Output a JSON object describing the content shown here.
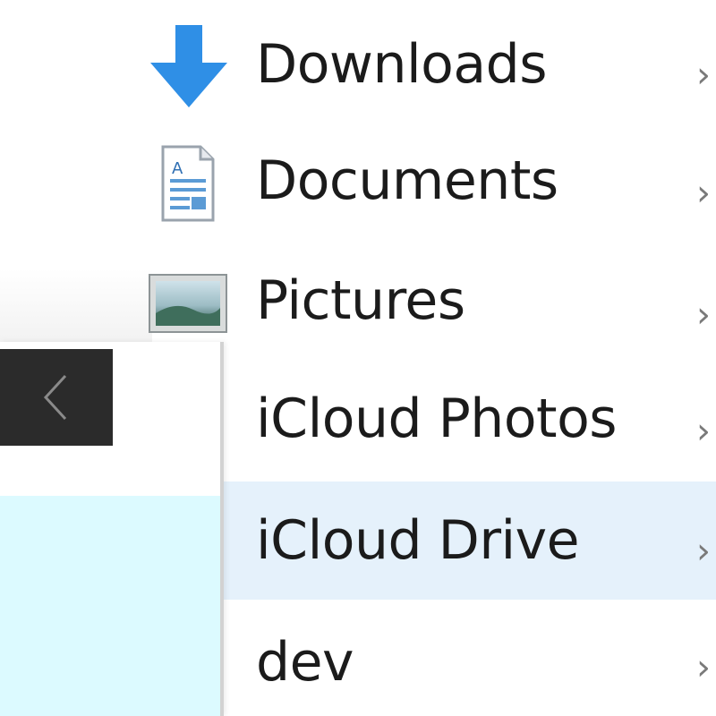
{
  "navigation": {
    "items": [
      {
        "label": "Downloads",
        "icon": "download-arrow-icon",
        "selected": false
      },
      {
        "label": "Documents",
        "icon": "documents-icon",
        "selected": false
      },
      {
        "label": "Pictures",
        "icon": "pictures-icon",
        "selected": false
      },
      {
        "label": "iCloud Photos",
        "icon": "none",
        "selected": false
      },
      {
        "label": "iCloud Drive",
        "icon": "none",
        "selected": true
      },
      {
        "label": "dev",
        "icon": "none",
        "selected": false
      }
    ],
    "pin_glyph": "›"
  },
  "back_button": {
    "icon": "chevron-left-icon",
    "glyph": "‹"
  },
  "colors": {
    "selected_row": "#e5f1fb",
    "panel_selected": "#dcfaff",
    "back_button_bg": "#2b2b2b",
    "download_arrow": "#2f8fe6",
    "text": "#1b1b1b"
  }
}
